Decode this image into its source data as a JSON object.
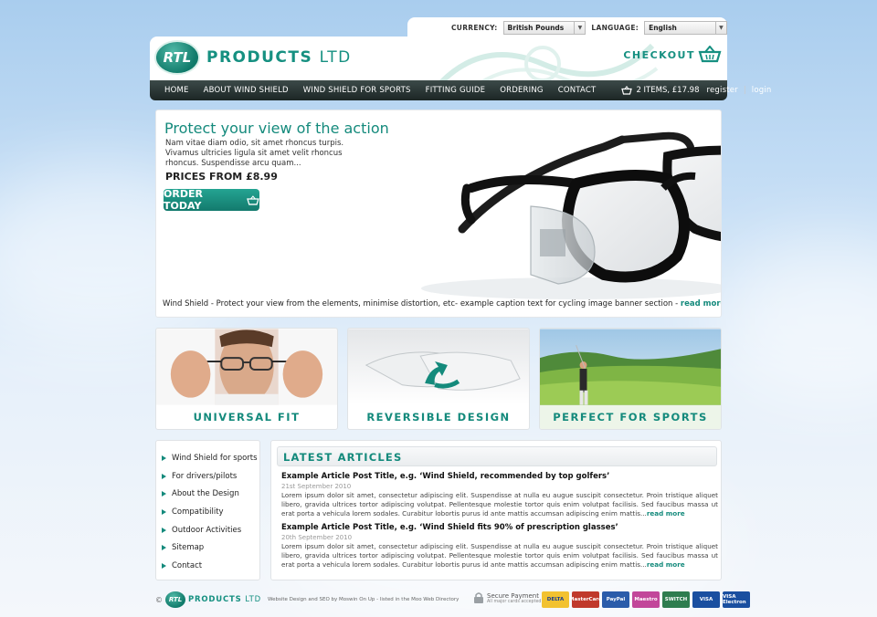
{
  "topbar": {
    "currency_label": "CURRENCY:",
    "currency_value": "British Pounds",
    "language_label": "LANGUAGE:",
    "language_value": "English"
  },
  "header": {
    "logo_badge": "RTL",
    "logo_name": "PRODUCTS",
    "logo_suffix": "LTD",
    "checkout_label": "CHECKOUT"
  },
  "nav": {
    "items": [
      {
        "label": "HOME"
      },
      {
        "label": "ABOUT WIND SHIELD"
      },
      {
        "label": "WIND SHIELD FOR SPORTS"
      },
      {
        "label": "FITTING GUIDE"
      },
      {
        "label": "ORDERING"
      },
      {
        "label": "CONTACT"
      }
    ],
    "cart_text": "2 ITEMS, £17.98",
    "register_label": "register",
    "separator": "|",
    "login_label": "login"
  },
  "hero": {
    "title": "Protect your view of the action",
    "intro": "Nam vitae diam odio, sit amet rhoncus turpis. Vivamus ultricies ligula sit amet velit rhoncus rhoncus. Suspendisse arcu quam...",
    "price": "PRICES FROM £8.99",
    "order_label": "ORDER TODAY",
    "caption": "Wind Shield - Protect your view from the elements, minimise distortion, etc- example caption text for cycling image banner section - ",
    "read_more": "read more"
  },
  "features": [
    {
      "title": "UNIVERSAL FIT"
    },
    {
      "title": "REVERSIBLE DESIGN"
    },
    {
      "title": "PERFECT FOR SPORTS"
    }
  ],
  "sidebar": {
    "items": [
      {
        "label": "Wind Shield for sports"
      },
      {
        "label": "For drivers/pilots"
      },
      {
        "label": "About the Design"
      },
      {
        "label": "Compatibility"
      },
      {
        "label": "Outdoor Activities"
      },
      {
        "label": "Sitemap"
      },
      {
        "label": "Contact"
      }
    ]
  },
  "articles": {
    "heading": "LATEST ARTICLES",
    "posts": [
      {
        "title": "Example Article Post Title, e.g. ‘Wind Shield, recommended by top golfers’",
        "date": "21st September 2010",
        "body": "Lorem ipsum dolor sit amet, consectetur adipiscing elit. Suspendisse at nulla eu augue suscipit consectetur. Proin tristique aliquet libero, gravida ultrices tortor adipiscing volutpat. Pellentesque molestie tortor quis enim volutpat facilisis. Sed faucibus massa ut erat porta a vehicula lorem sodales. Curabitur lobortis purus id ante mattis accumsan adipiscing enim mattis...",
        "more": "read more"
      },
      {
        "title": "Example Article Post Title, e.g. ‘Wind Shield fits 90% of prescription glasses’",
        "date": "20th September 2010",
        "body": "Lorem ipsum dolor sit amet, consectetur adipiscing elit. Suspendisse at nulla eu augue suscipit consectetur. Proin tristique aliquet libero, gravida ultrices tortor adipiscing volutpat. Pellentesque molestie tortor quis enim volutpat facilisis. Sed faucibus massa ut erat porta a vehicula lorem sodales. Curabitur lobortis purus id ante mattis accumsan adipiscing enim mattis...",
        "more": "read more"
      }
    ]
  },
  "footer": {
    "copyright": "©",
    "logo_badge": "RTL",
    "logo_name": "PRODUCTS",
    "logo_suffix": "LTD",
    "credit": "Website Design and SEO by Moswin On Up - listed in the Moo Web Directory",
    "secure_title": "Secure Payment",
    "secure_sub": "All major cards accepted",
    "cards": [
      {
        "label": "DELTA",
        "color": "#f2c230"
      },
      {
        "label": "MasterCard",
        "color": "#c0392b"
      },
      {
        "label": "PayPal",
        "color": "#2a5caa"
      },
      {
        "label": "Maestro",
        "color": "#c2479a"
      },
      {
        "label": "SWITCH",
        "color": "#2e7d4f"
      },
      {
        "label": "VISA",
        "color": "#1a4fa0"
      },
      {
        "label": "VISA Electron",
        "color": "#1a4fa0"
      }
    ]
  }
}
